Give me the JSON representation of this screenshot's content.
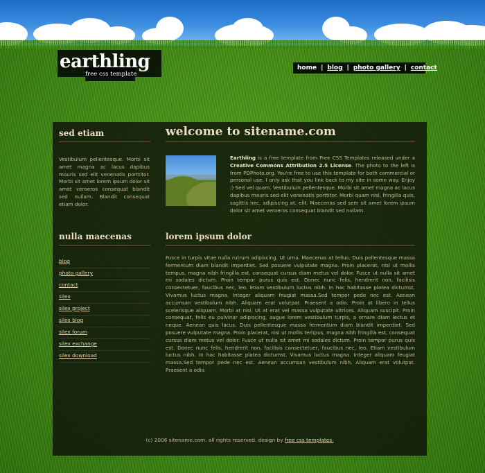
{
  "logo": {
    "title": "earthling",
    "subtitle": "free css template"
  },
  "nav": {
    "items": [
      "home",
      "blog",
      "photo gallery",
      "contact"
    ],
    "separator": "|"
  },
  "sidebar": {
    "section1": {
      "heading": "sed etiam",
      "text": "Vestibulum pellentesque. Morbi sit amet magna ac lacus dapibus mauris sed elit venenatis porttitor. Morbi sit amet lorem ipsum dolor sit amet veroeros consequat blandit sed nullam. Blandit consequat etiam dolor."
    },
    "section2": {
      "heading": "nulla maecenas",
      "links": [
        "blog",
        "photo gallery",
        "contact",
        "silex",
        "silex project",
        "silex blog",
        "silex forum",
        "silex exchange",
        "silex download"
      ]
    }
  },
  "main": {
    "welcome_heading": "welcome to sitename.com",
    "intro": {
      "brand": "Earthling",
      "part1": " is a free template from Free CSS Templates released under a ",
      "license": "Creative Commons Attribution 2.5 License",
      "part2": ". The photo to the left is from PDPhoto.org. You're free to use this template for both commercial or personal use. I only ask that you link back to my site in some way. Enjoy :) Sed vel quam. Vestibulum pellentesque. Morbi sit amet magna ac lacus dapibus mauris sed elit venenatis porttitor. Morbi quam nisl, fringilla quis, sagittis nec, adipiscing at, elit. Maecenas sed sem sit amet lorem ipsum dolor sit amet veroeros consequat blandit sed nullam."
    },
    "section2_heading": "lorem ipsum dolor",
    "body": "Fusce in turpis vitae nulla rutrum adipiscing. Ut urna. Maecenas at tellus. Duis pellentesque massa fermentum diam blandit imperdiet. Sed posuere vulputate magna. Proin placerat, nisl ut mollis tempus, magna nibh fringilla est, consequat cursus diam metus vel dolor. Fusce ut nulla sit amet mi sodales dictum. Proin tempor purus quis est. Donec nunc felis, hendrerit non, facilisis consectetuer, faucibus nec, leo. Etiam vestibulum luctus nibh. In hac habitasse platea dictumst. Vivamus luctus magna. Integer aliquam feugiat massa.Sed tempor pede nec est. Aenean accumsan vestibulum nibh. Aliquam erat volutpat. Praesent a odio. Proin at libero in tellus scelerisque aliquam. Morbi at nisi. Ut at erat vel massa vulputate ultrices. Aliquam suscipit. Proin consequat, felis eu pulvinar adipiscing, augue lorem vestibulum turpis, a ornare diam lectus et neque. Aenean quis lacus. Duis pellentesque massa fermentum diam blandit imperdiet. Sed posuere vulputate magna. Proin placerat, nisl ut mollis tempus, magna nibh fringilla est, consequat cursus diam metus vel dolor. Fusce ut nulla sit amet mi sodales dictum. Proin tempor purus quis est. Donec nunc felis, hendrerit non, facilisis consectetuer, faucibus nec, leo. Etiam vestibulum luctus nibh. In hac habitasse platea dictumst. Vivamus luctus magna. Integer aliquam feugiat massa.Sed tempor pede nec est. Aenean accumsan vestibulum nibh. Aliquam erat volutpat. Praesent a odio."
  },
  "footer": {
    "text": "(c) 2006 sitename.com. all rights reserved. design by ",
    "link": "free css templates."
  },
  "colors": {
    "panel": "#12160a",
    "heading": "#ecdcc0",
    "text": "#c9b896",
    "sky": "#3d8ee0",
    "grass": "#3f8a12"
  },
  "icons": {
    "photo": "landscape-photo"
  }
}
